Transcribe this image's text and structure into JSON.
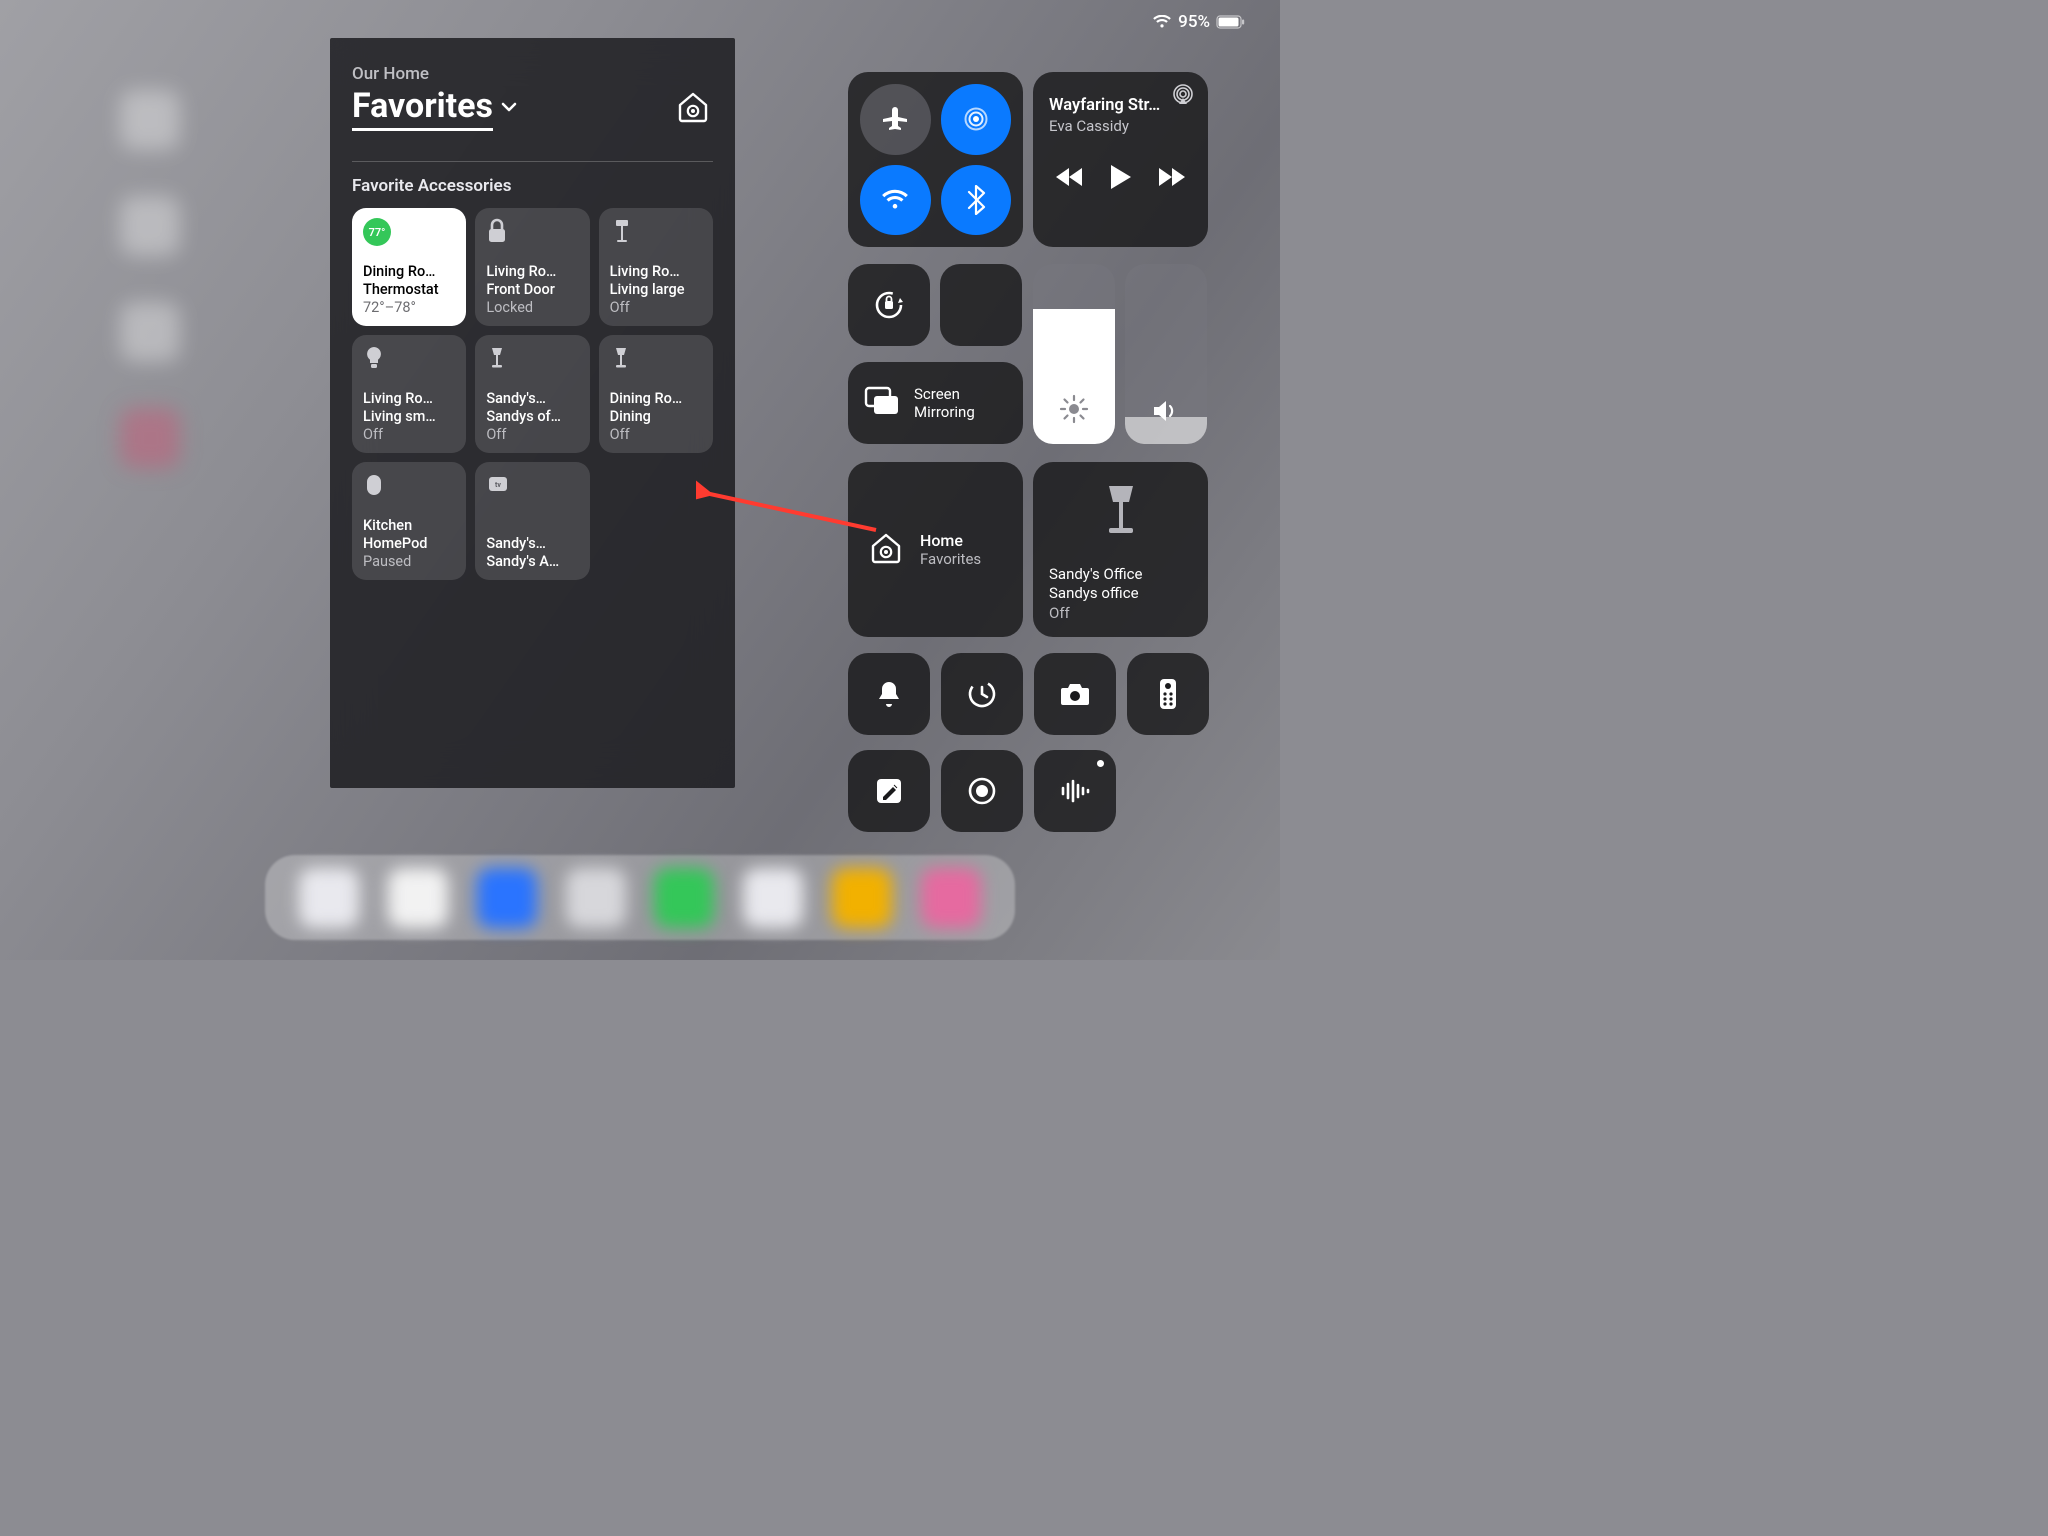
{
  "status": {
    "battery_pct": "95%"
  },
  "home_panel": {
    "subtitle": "Our Home",
    "title": "Favorites",
    "section_label": "Favorite Accessories",
    "tiles": [
      {
        "badge": "77°",
        "l1": "Dining Ro…",
        "l2": "Thermostat",
        "l3": "72°–78°"
      },
      {
        "l1": "Living Ro…",
        "l2": "Front Door",
        "l3": "Locked"
      },
      {
        "l1": "Living Ro…",
        "l2": "Living large",
        "l3": "Off"
      },
      {
        "l1": "Living Ro…",
        "l2": "Living sm…",
        "l3": "Off"
      },
      {
        "l1": "Sandy's…",
        "l2": "Sandys of…",
        "l3": "Off"
      },
      {
        "l1": "Dining Ro…",
        "l2": "Dining",
        "l3": "Off"
      },
      {
        "l1": "Kitchen",
        "l2": "HomePod",
        "l3": "Paused"
      },
      {
        "l1": "Sandy's…",
        "l2": "Sandy's A…",
        "l3": ""
      }
    ]
  },
  "media": {
    "title": "Wayfaring Str…",
    "artist": "Eva Cassidy"
  },
  "screen_mirroring": {
    "label1": "Screen",
    "label2": "Mirroring"
  },
  "home_fav": {
    "title": "Home",
    "subtitle": "Favorites"
  },
  "sandys_office": {
    "l1": "Sandy's Office",
    "l2": "Sandys office",
    "l3": "Off"
  },
  "brightness_pct": 75,
  "volume_pct": 15,
  "colors": {
    "accent_blue": "#0a7aff",
    "green": "#34c759",
    "arrow": "#ff3b30"
  }
}
